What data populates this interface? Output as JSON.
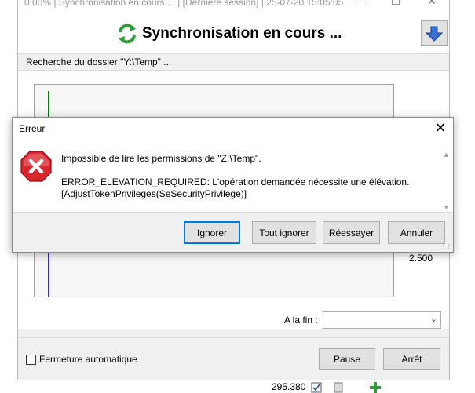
{
  "main_window": {
    "title": "0,00% | Synchronisation en cours ... | [Dernière session] | 25-07-20 15:05:05",
    "title_minimize": "—",
    "title_maximize": "☐",
    "title_close": "✕",
    "header_title": "Synchronisation en cours ...",
    "status_text": "Recherche du dossier \"Y:\\Temp\" ...",
    "side_value": "2.500",
    "on_finish_label": "A la fin :",
    "on_finish_value": "",
    "auto_close_label": "Fermeture automatique",
    "auto_close_checked": false,
    "pause_label": "Pause",
    "stop_label": "Arrêt",
    "below_number": "295.380"
  },
  "error_dialog": {
    "title": "Erreur",
    "close_glyph": "✕",
    "message_line1": "Impossible de lire les permissions de \"Z:\\Temp\".",
    "message_line2": "ERROR_ELEVATION_REQUIRED: L'opération demandée nécessite une élévation.",
    "message_line3": "[AdjustTokenPrivileges(SeSecurityPrivilege)]",
    "buttons": {
      "ignore": "Ignorer",
      "ignore_all": "Tout ignorer",
      "retry": "Réessayer",
      "cancel": "Annuler"
    }
  },
  "colors": {
    "error_red": "#d9262c",
    "sync_green": "#2e9e3a",
    "accent_blue": "#0078d7",
    "graph_green": "#008000",
    "graph_blue": "#2d2dd0"
  },
  "icons": {
    "sync": "sync-arrows-icon",
    "down_arrow": "arrow-down-icon",
    "error": "error-x-icon",
    "dropdown": "chevron-down-icon"
  }
}
